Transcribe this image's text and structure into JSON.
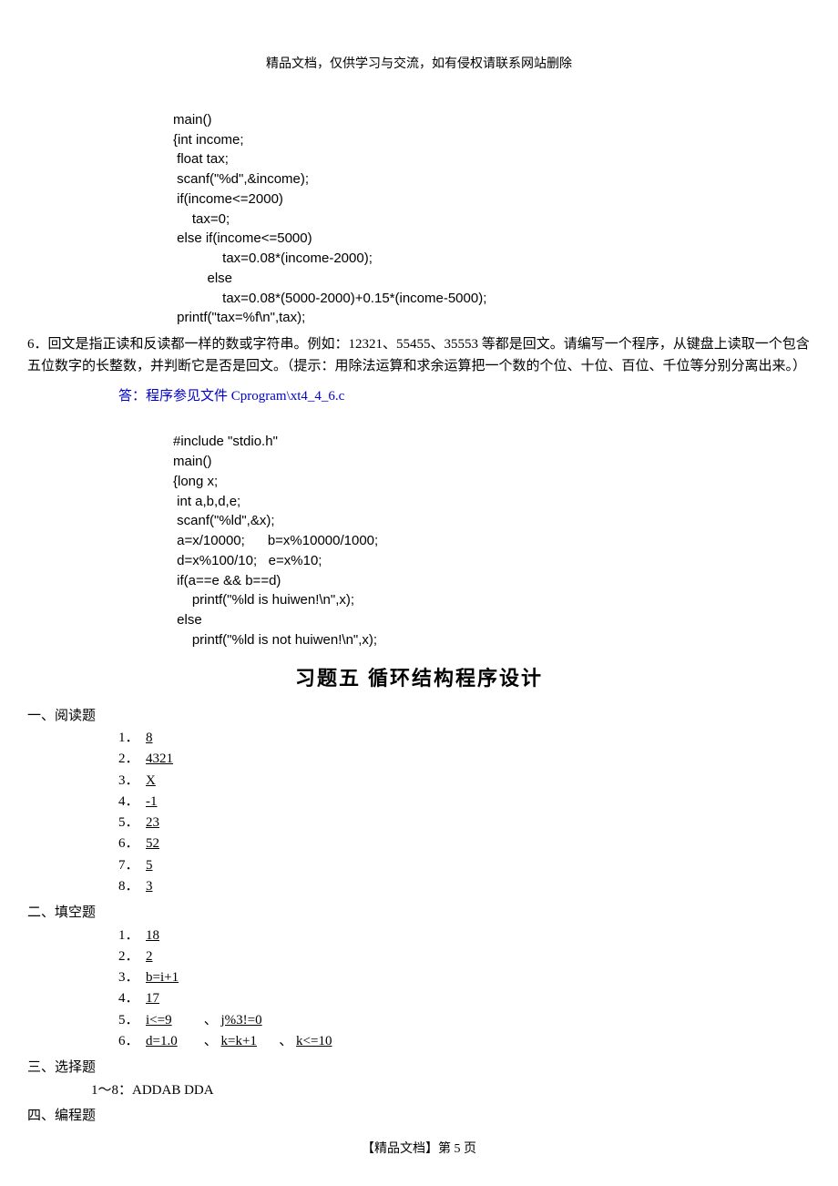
{
  "header": {
    "note": "精品文档，仅供学习与交流，如有侵权请联系网站删除"
  },
  "code1": {
    "l1": "main()",
    "l2": "{int income;",
    "l3": " float tax;",
    "l4": " scanf(\"%d\",&income);",
    "l5": " if(income<=2000)",
    "l6": "     tax=0;",
    "l7": " else if(income<=5000)",
    "l8": "             tax=0.08*(income-2000);",
    "l9": "         else",
    "l10": "             tax=0.08*(5000-2000)+0.15*(income-5000);",
    "l11": " printf(\"tax=%f\\n\",tax);"
  },
  "question6": {
    "text": "6．回文是指正读和反读都一样的数或字符串。例如：12321、55455、35553 等都是回文。请编写一个程序，从键盘上读取一个包含五位数字的长整数，并判断它是否是回文。（提示：用除法运算和求余运算把一个数的个位、十位、百位、千位等分别分离出来。）"
  },
  "answer6": {
    "label": "答：程序参见文件 Cprogram\\xt4_4_6.c"
  },
  "code2": {
    "l1": "#include \"stdio.h\"",
    "l2": "main()",
    "l3": "{long x;",
    "l4": " int a,b,d,e;",
    "l5": " scanf(\"%ld\",&x);",
    "l6": " a=x/10000;      b=x%10000/1000;",
    "l7": " d=x%100/10;   e=x%10;",
    "l8": " if(a==e && b==d)",
    "l9": "     printf(\"%ld is huiwen!\\n\",x);",
    "l10": " else",
    "l11": "     printf(\"%ld is not huiwen!\\n\",x);"
  },
  "chapter": {
    "title": "习题五    循环结构程序设计"
  },
  "section1": {
    "heading": "一、阅读题",
    "items": [
      {
        "n": "1．",
        "v": "8"
      },
      {
        "n": "2．",
        "v": "4321"
      },
      {
        "n": "3．",
        "v": "X"
      },
      {
        "n": "4．",
        "v": "-1"
      },
      {
        "n": "5．",
        "v": "23"
      },
      {
        "n": "6．",
        "v": "52"
      },
      {
        "n": "7．",
        "v": "5"
      },
      {
        "n": "8．",
        "v": "3"
      }
    ]
  },
  "section2": {
    "heading": "二、填空题",
    "items": [
      {
        "n": "1．",
        "vals": [
          "    18    "
        ]
      },
      {
        "n": "2．",
        "vals": [
          "    2    "
        ]
      },
      {
        "n": "3．",
        "vals": [
          "   b=i+1   "
        ]
      },
      {
        "n": "4．",
        "vals": [
          "    17    "
        ]
      },
      {
        "n": "5．",
        "vals": [
          "   i<=9    ",
          "   j%3!=0    "
        ]
      },
      {
        "n": "6．",
        "vals": [
          "   d=1.0   ",
          "    k=k+1    ",
          "   k<=10   "
        ]
      }
    ],
    "sep": "、"
  },
  "section3": {
    "heading": "三、选择题",
    "ans": "1～8：ADDAB    DDA"
  },
  "section4": {
    "heading": "四、编程题"
  },
  "footer": {
    "text": "【精品文档】第 5 页"
  }
}
